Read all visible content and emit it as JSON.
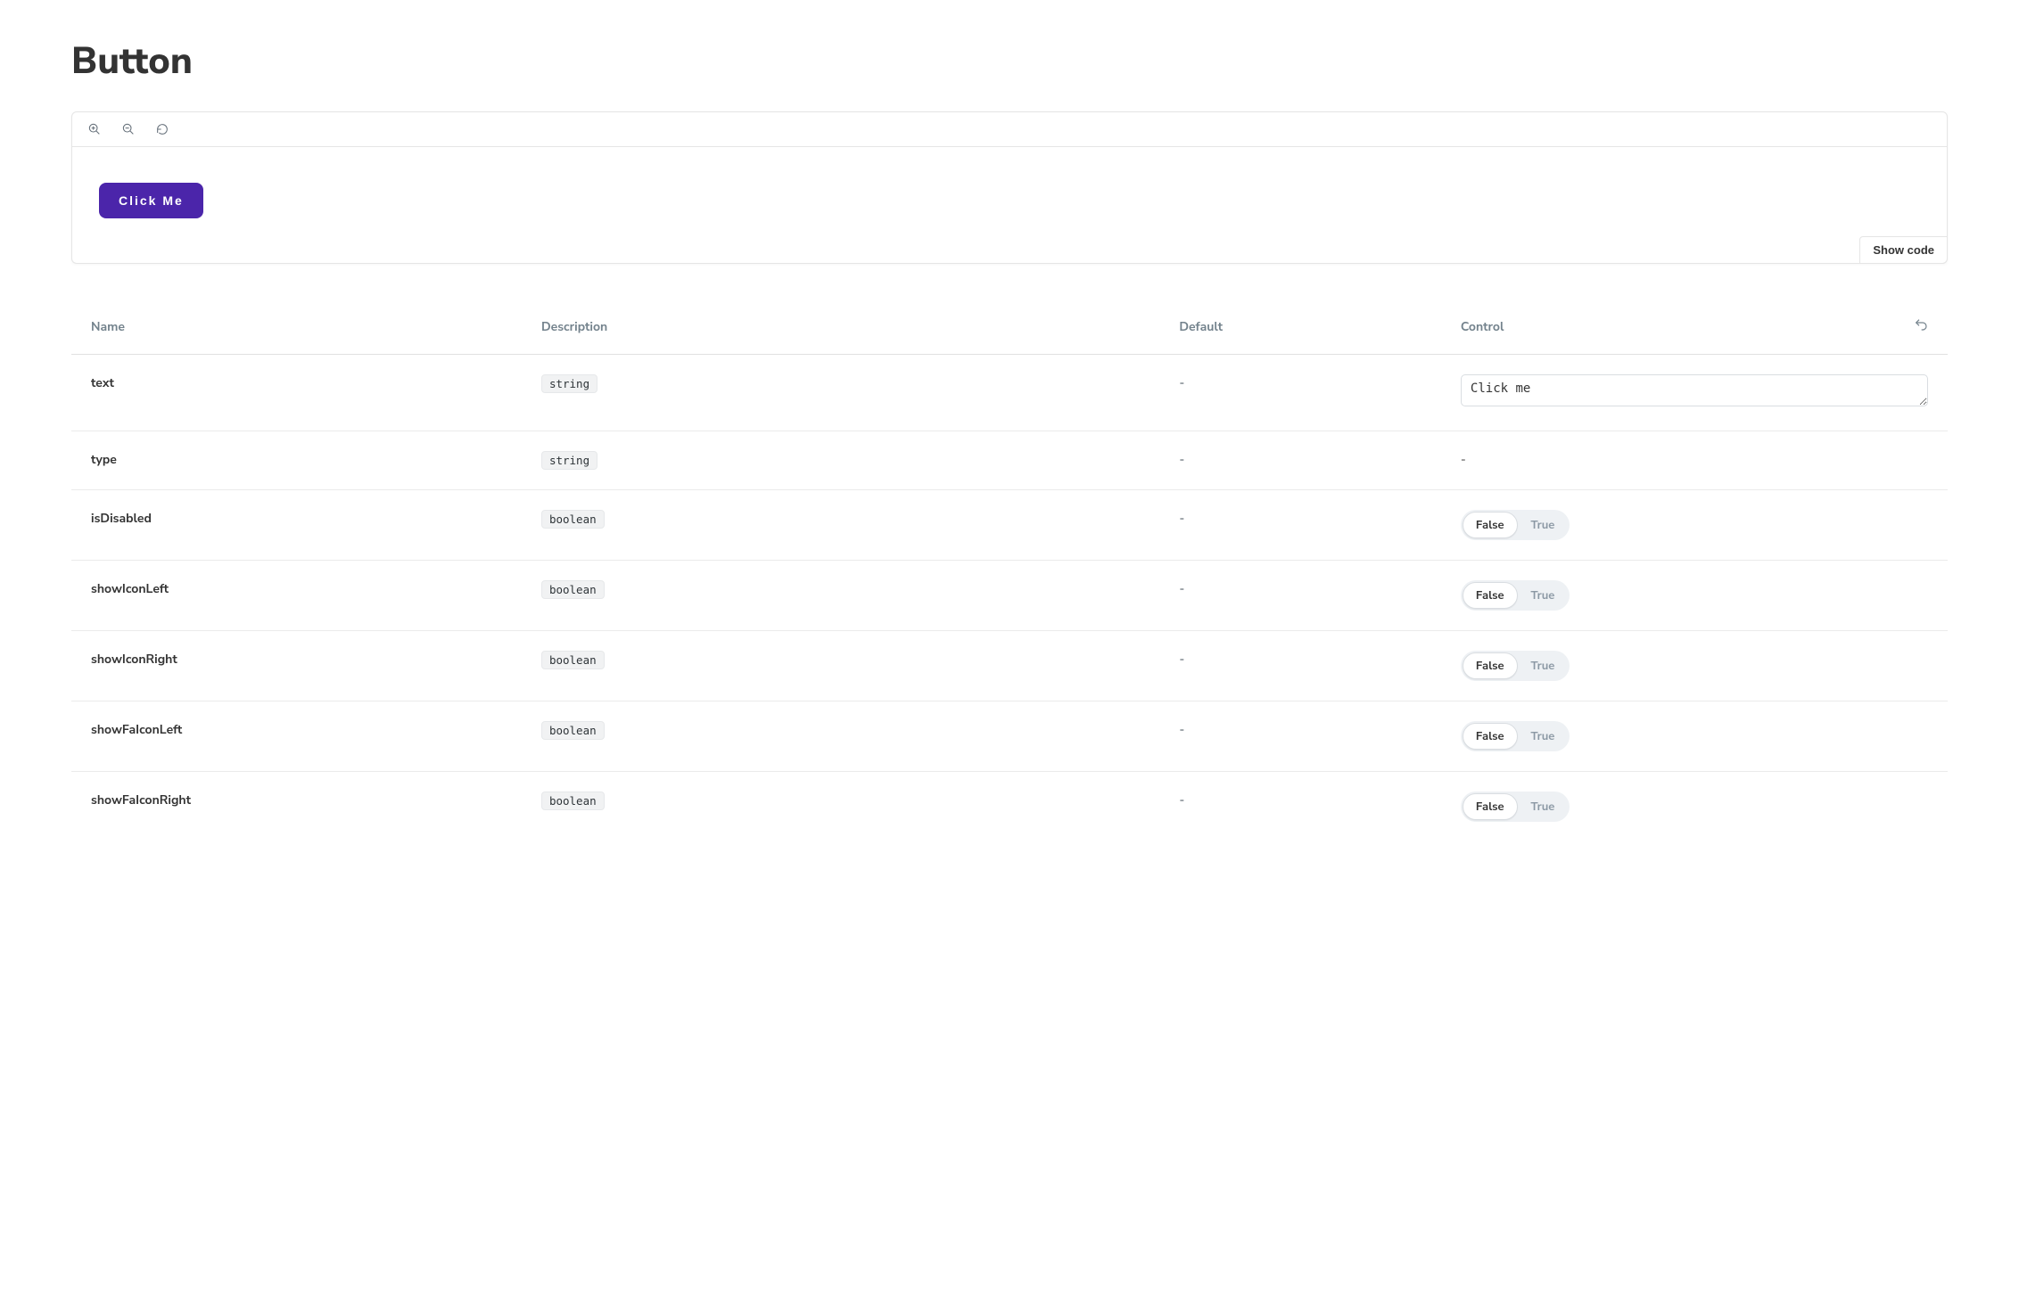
{
  "title": "Button",
  "preview": {
    "button_label": "Click Me",
    "show_code_label": "Show code"
  },
  "columns": {
    "name": "Name",
    "description": "Description",
    "default": "Default",
    "control": "Control"
  },
  "toggle": {
    "false_label": "False",
    "true_label": "True"
  },
  "args": [
    {
      "name": "text",
      "type": "string",
      "default": "-",
      "control_kind": "text",
      "value": "Click me"
    },
    {
      "name": "type",
      "type": "string",
      "default": "-",
      "control_kind": "none",
      "value": "-"
    },
    {
      "name": "isDisabled",
      "type": "boolean",
      "default": "-",
      "control_kind": "bool",
      "value": false
    },
    {
      "name": "showIconLeft",
      "type": "boolean",
      "default": "-",
      "control_kind": "bool",
      "value": false
    },
    {
      "name": "showIconRight",
      "type": "boolean",
      "default": "-",
      "control_kind": "bool",
      "value": false
    },
    {
      "name": "showFaIconLeft",
      "type": "boolean",
      "default": "-",
      "control_kind": "bool",
      "value": false
    },
    {
      "name": "showFaIconRight",
      "type": "boolean",
      "default": "-",
      "control_kind": "bool",
      "value": false
    }
  ]
}
